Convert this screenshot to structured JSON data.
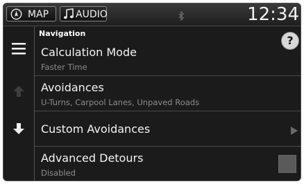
{
  "topbar": {
    "map_label": "MAP",
    "audio_label": "AUDIO",
    "clock": "12:34"
  },
  "section": {
    "title": "Navigation",
    "help": "?"
  },
  "rows": [
    {
      "label": "Calculation Mode",
      "sub": "Faster Time"
    },
    {
      "label": "Avoidances",
      "sub": "U-Turns, Carpool Lanes, Unpaved Roads"
    },
    {
      "label": "Custom Avoidances",
      "sub": ""
    },
    {
      "label": "Advanced Detours",
      "sub": "Disabled"
    }
  ],
  "icons": {
    "map": "compass-icon",
    "audio": "music-note-icon",
    "bluetooth": "bluetooth-icon",
    "menu": "menu-icon",
    "up": "scroll-up-icon",
    "down": "scroll-down-icon",
    "chevron": "chevron-right-icon"
  },
  "colors": {
    "background": "#1b1b1b",
    "text": "#f4f4f4",
    "subtext": "#8c8c8c",
    "divider": "#4a4a4a"
  }
}
